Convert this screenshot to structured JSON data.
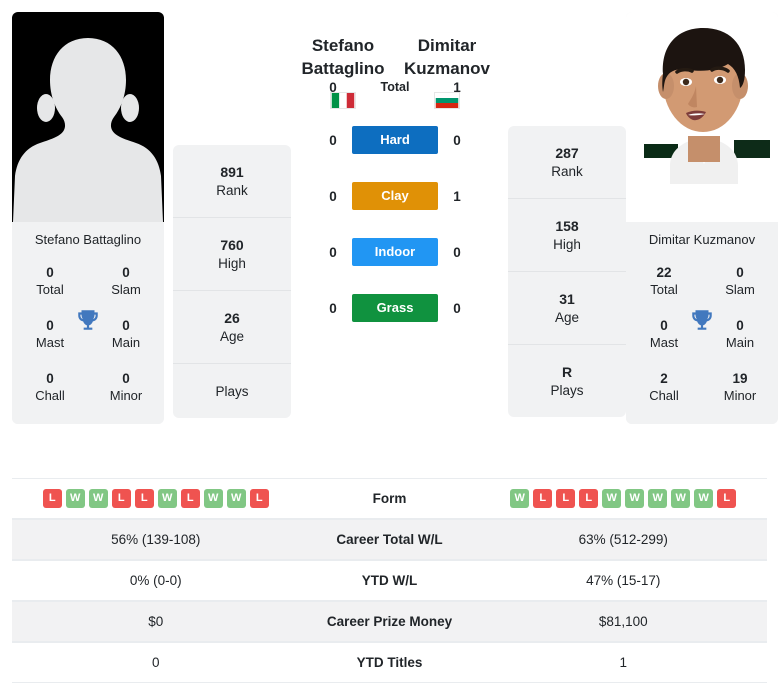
{
  "players": {
    "left": {
      "first_name": "Stefano",
      "last_name": "Battaglino",
      "full_name": "Stefano Battaglino",
      "photo_type": "silhouette-placeholder",
      "flag": "italy-flag-icon",
      "flag_colors": [
        "#009246",
        "#ffffff",
        "#ce2b37"
      ],
      "rank": "891",
      "rank_label": "Rank",
      "high": "760",
      "high_label": "High",
      "age": "26",
      "age_label": "Age",
      "plays": "",
      "plays_label": "Plays",
      "titles": {
        "total": "0",
        "total_label": "Total",
        "slam": "0",
        "slam_label": "Slam",
        "mast": "0",
        "mast_label": "Mast",
        "main": "0",
        "main_label": "Main",
        "chall": "0",
        "chall_label": "Chall",
        "minor": "0",
        "minor_label": "Minor"
      },
      "form": [
        "L",
        "W",
        "W",
        "L",
        "L",
        "W",
        "L",
        "W",
        "W",
        "L"
      ],
      "career_wl": "56% (139-108)",
      "ytd_wl": "0% (0-0)",
      "prize_money": "$0",
      "ytd_titles": "0"
    },
    "right": {
      "first_name": "Dimitar",
      "last_name": "Kuzmanov",
      "full_name": "Dimitar Kuzmanov",
      "photo_type": "player-photo",
      "flag": "bulgaria-flag-icon",
      "flag_colors": [
        "#ffffff",
        "#00966e",
        "#d62612"
      ],
      "rank": "287",
      "rank_label": "Rank",
      "high": "158",
      "high_label": "High",
      "age": "31",
      "age_label": "Age",
      "plays": "R",
      "plays_label": "Plays",
      "titles": {
        "total": "22",
        "total_label": "Total",
        "slam": "0",
        "slam_label": "Slam",
        "mast": "0",
        "mast_label": "Mast",
        "main": "0",
        "main_label": "Main",
        "chall": "2",
        "chall_label": "Chall",
        "minor": "19",
        "minor_label": "Minor"
      },
      "form": [
        "W",
        "L",
        "L",
        "L",
        "W",
        "W",
        "W",
        "W",
        "W",
        "L"
      ],
      "career_wl": "63% (512-299)",
      "ytd_wl": "47% (15-17)",
      "prize_money": "$81,100",
      "ytd_titles": "1"
    }
  },
  "head_to_head": {
    "total": {
      "label": "Total",
      "left": "0",
      "right": "1"
    },
    "surfaces": [
      {
        "label": "Hard",
        "left": "0",
        "right": "0",
        "color": "#0d6ec0"
      },
      {
        "label": "Clay",
        "left": "0",
        "right": "1",
        "color": "#e09106"
      },
      {
        "label": "Indoor",
        "left": "0",
        "right": "0",
        "color": "#2196f3"
      },
      {
        "label": "Grass",
        "left": "0",
        "right": "0",
        "color": "#10923f"
      }
    ]
  },
  "stats_table": {
    "form_label": "Form",
    "career_wl_label": "Career Total W/L",
    "ytd_wl_label": "YTD W/L",
    "prize_money_label": "Career Prize Money",
    "ytd_titles_label": "YTD Titles"
  },
  "colors": {
    "win_badge": "#81c784",
    "loss_badge": "#ef5350",
    "card_background": "#f1f2f3",
    "row_stripe": "#f2f2f3",
    "trophy": "#4178be"
  }
}
